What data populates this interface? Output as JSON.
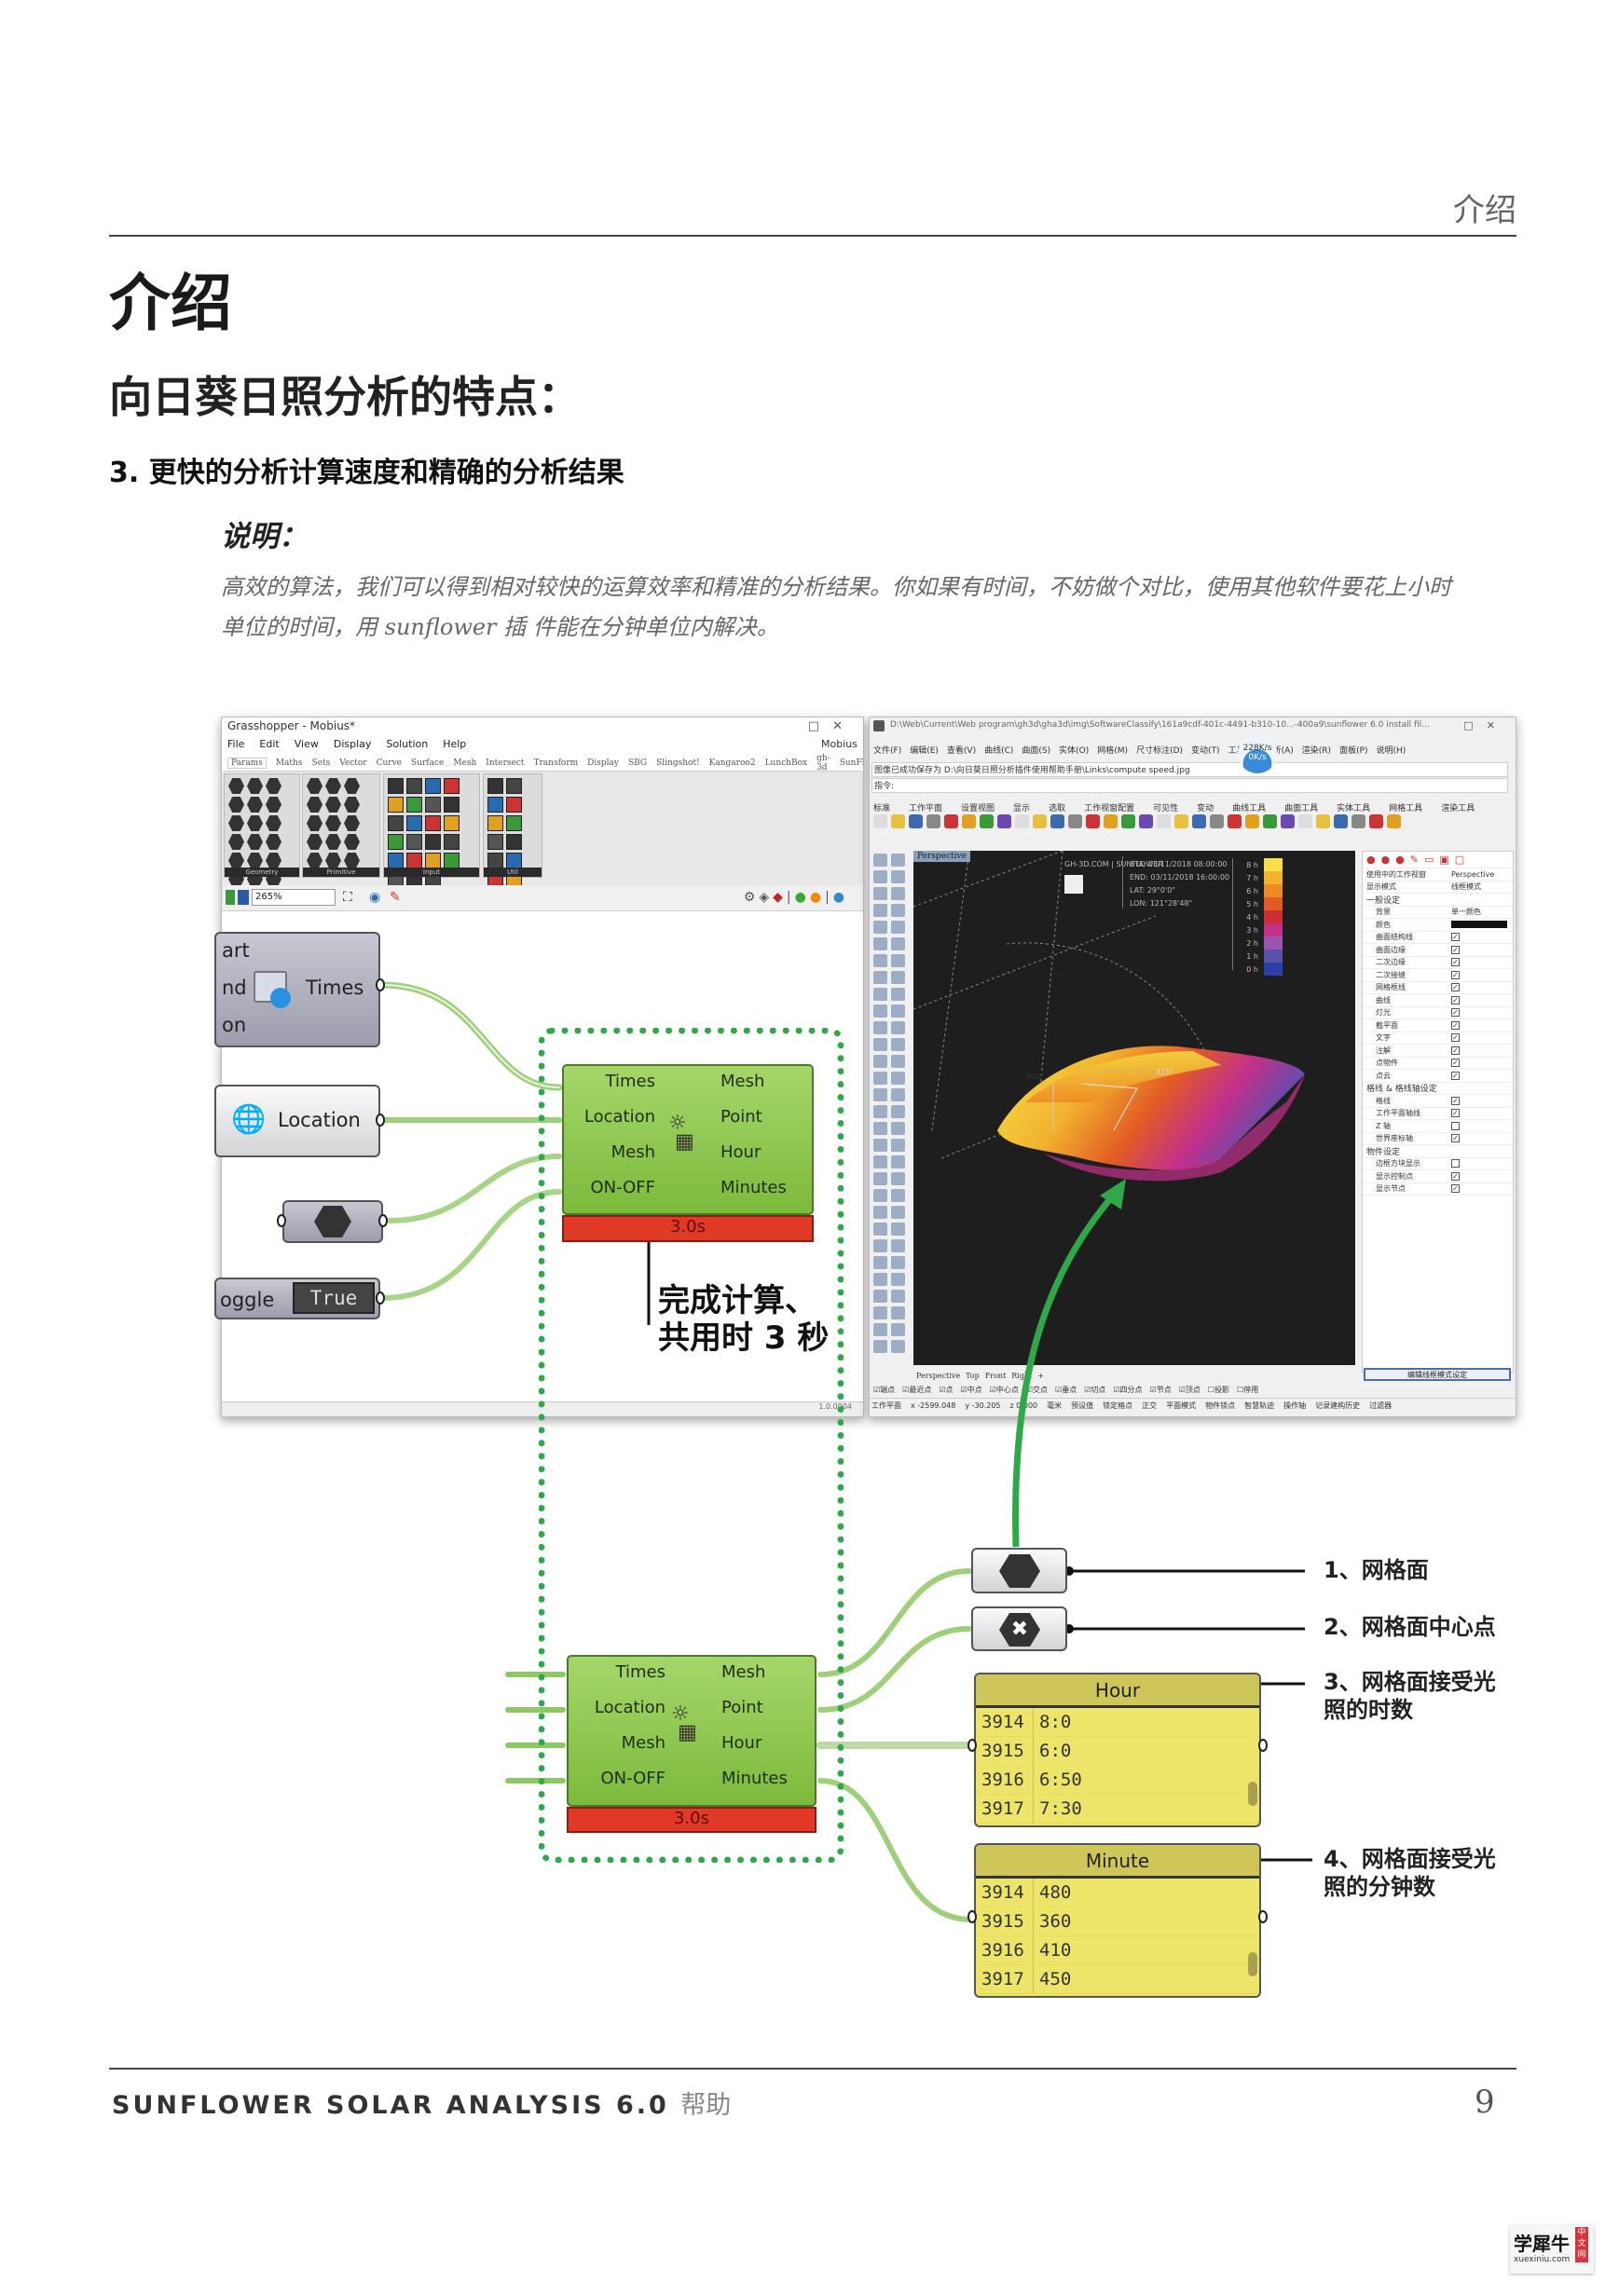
{
  "header": {
    "section": "介绍"
  },
  "title": "介绍",
  "subtitle": "向日葵日照分析的特点：",
  "section_heading": "3.  更快的分析计算速度和精确的分析结果",
  "note_label": "说明：",
  "paragraph_lines": [
    "高效的算法，我们可以得到相对较快的运算效率和精准的分析结果。你如果有时间，不妨做个对比，使用其他软件要花上小时",
    "单位的时间，用 sunflower 插 件能在分钟单位内解决。"
  ],
  "grasshopper": {
    "title": "Grasshopper - Mobius*",
    "window_controls": [
      "□",
      "✕"
    ],
    "menu": [
      "File",
      "Edit",
      "View",
      "Display",
      "Solution",
      "Help"
    ],
    "menu_right": "Mobius",
    "tabs": [
      "Params",
      "Maths",
      "Sets",
      "Vector",
      "Curve",
      "Surface",
      "Mesh",
      "Intersect",
      "Transform",
      "Display",
      "SBG",
      "Slingshot!",
      "Kangaroo2",
      "LunchBox",
      "gh-3d",
      "SunFlower"
    ],
    "ribbon_panels": [
      "Geometry",
      "Primitive",
      "Input",
      "Util"
    ],
    "zoom": "265%",
    "status": "1.0.0004",
    "time_component": {
      "inputs_partial": [
        "art",
        "nd",
        "on"
      ],
      "output": "Times"
    },
    "location_component": {
      "label": "Location"
    },
    "toggle_component": {
      "label_partial": "oggle",
      "value": "True"
    },
    "sunflower_component": {
      "inputs": [
        "Times",
        "Location",
        "Mesh",
        "ON-OFF"
      ],
      "outputs": [
        "Mesh",
        "Point",
        "Hour",
        "Minutes"
      ],
      "runtime": "3.0s"
    }
  },
  "annotation": [
    "完成计算、",
    "共用时 3 秒"
  ],
  "rhino": {
    "title": "D:\\Web\\Current\\Web program\\gh3d\\gha3d\\img\\SoftwareClassify\\161a9cdf-401c-4491-b310-10...-400a9\\sunflower 6.0 install fil...",
    "window_controls": [
      "□",
      "✕"
    ],
    "menu": [
      "文件(F)",
      "编辑(E)",
      "查看(V)",
      "曲线(C)",
      "曲面(S)",
      "实体(O)",
      "网格(M)",
      "尺寸标注(D)",
      "变动(T)",
      "工具(L)",
      "分析(A)",
      "渲染(R)",
      "面板(P)",
      "说明(H)"
    ],
    "command_history": "图像已成功保存为 D:\\向日葵日照分析插件使用帮助手册\\Links\\compute speed.jpg",
    "command_prompt": "指令:",
    "network": {
      "up": "228K/s",
      "down": "0K/s"
    },
    "toolbar_tabs": [
      "标准",
      "工作平面",
      "设置视图",
      "显示",
      "选取",
      "工作视窗配置",
      "可见性",
      "变动",
      "曲线工具",
      "曲面工具",
      "实体工具",
      "网格工具",
      "渲染工具"
    ],
    "viewport_label": "Perspective",
    "info": [
      "GH-3D.COM | SUNFLOWER",
      "STA: 03/11/2018 08:00:00",
      "END: 03/11/2018 16:00:00",
      "LAT: 29°0'0\"",
      "LON: 121°28'48\""
    ],
    "angle_labels": [
      "300°",
      "315°"
    ],
    "legend": [
      {
        "label": "8 h",
        "color": "#f5e04a"
      },
      {
        "label": "7 h",
        "color": "#f2b32e"
      },
      {
        "label": "6 h",
        "color": "#ee8a24"
      },
      {
        "label": "5 h",
        "color": "#e25a24"
      },
      {
        "label": "4 h",
        "color": "#cc2e34"
      },
      {
        "label": "3 h",
        "color": "#c2308a"
      },
      {
        "label": "2 h",
        "color": "#9a56b0"
      },
      {
        "label": "1 h",
        "color": "#5a50b0"
      },
      {
        "label": "0 h",
        "color": "#2a40a8"
      }
    ],
    "properties": {
      "active_viewport": {
        "label": "使用中的工作视窗",
        "value": "Perspective"
      },
      "display_mode": {
        "label": "显示模式",
        "value": "线框模式"
      },
      "general_header": "一般设定",
      "background": {
        "label": "背景",
        "value": "单一颜色"
      },
      "color_label": "颜色",
      "general_items": [
        {
          "label": "曲面结构线",
          "checked": true
        },
        {
          "label": "曲面边缘",
          "checked": true
        },
        {
          "label": "二次边缘",
          "checked": true
        },
        {
          "label": "二次接缝",
          "checked": true
        },
        {
          "label": "网格框线",
          "checked": true
        },
        {
          "label": "曲线",
          "checked": true
        },
        {
          "label": "灯光",
          "checked": true
        },
        {
          "label": "截平面",
          "checked": true
        },
        {
          "label": "文字",
          "checked": true
        },
        {
          "label": "注解",
          "checked": true
        },
        {
          "label": "点物件",
          "checked": true
        },
        {
          "label": "点云",
          "checked": true
        }
      ],
      "grid_header": "格线 & 格线轴设定",
      "grid_items": [
        {
          "label": "格线",
          "checked": true
        },
        {
          "label": "工作平面轴线",
          "checked": true
        },
        {
          "label": "Z 轴",
          "checked": false
        },
        {
          "label": "世界座标轴",
          "checked": true
        }
      ],
      "object_header": "物件设定",
      "object_items": [
        {
          "label": "边框方块显示",
          "checked": false
        },
        {
          "label": "显示控制点",
          "checked": true
        },
        {
          "label": "显示节点",
          "checked": true
        }
      ],
      "edit_button": "编辑线框模式设定"
    },
    "viewport_tabs": [
      "Perspective",
      "Top",
      "Front",
      "Right",
      "+"
    ],
    "osnaps": [
      "☑端点",
      "☑最近点",
      "☑点",
      "☑中点",
      "☑中心点",
      "☑交点",
      "☑垂点",
      "☑切点",
      "☑四分点",
      "☑节点",
      "☑顶点",
      "☐投影",
      "☐停用"
    ],
    "status": [
      "工作平面",
      "x -2599.048",
      "y -30.205",
      "z 0.000",
      "毫米",
      "预设值",
      "锁定格点",
      "正交",
      "平面模式",
      "物件锁点",
      "智慧轨迹",
      "操作轴",
      "记录建构历史",
      "过滤器"
    ]
  },
  "outputs": {
    "sunflower_component": {
      "inputs": [
        "Times",
        "Location",
        "Mesh",
        "ON-OFF"
      ],
      "outputs": [
        "Mesh",
        "Point",
        "Hour",
        "Minutes"
      ],
      "runtime": "3.0s"
    },
    "hour_panel": {
      "title": "Hour",
      "rows": [
        {
          "index": "3914",
          "value": "8:0"
        },
        {
          "index": "3915",
          "value": "6:0"
        },
        {
          "index": "3916",
          "value": "6:50"
        },
        {
          "index": "3917",
          "value": "7:30"
        }
      ]
    },
    "minute_panel": {
      "title": "Minute",
      "rows": [
        {
          "index": "3914",
          "value": "480"
        },
        {
          "index": "3915",
          "value": "360"
        },
        {
          "index": "3916",
          "value": "410"
        },
        {
          "index": "3917",
          "value": "450"
        }
      ]
    },
    "callouts": {
      "mesh": "1、网格面",
      "center": "2、网格面中心点",
      "hours": [
        "3、网格面接受光",
        "照的时数"
      ],
      "minutes": [
        "4、网格面接受光",
        "照的分钟数"
      ]
    }
  },
  "colors": {
    "dotted_border": "#2fa84a",
    "arrow": "#2fa84a",
    "component": "#8cc84b",
    "runtime_bar": "#e03a26",
    "panel": "#ede56a"
  },
  "footer": {
    "title": "SUNFLOWER SOLAR ANALYSIS 6.0",
    "suffix": "帮助",
    "page_number": "9"
  },
  "watermark": {
    "text": "学犀牛",
    "tag": "中文网",
    "url": "xuexiniu.com"
  }
}
